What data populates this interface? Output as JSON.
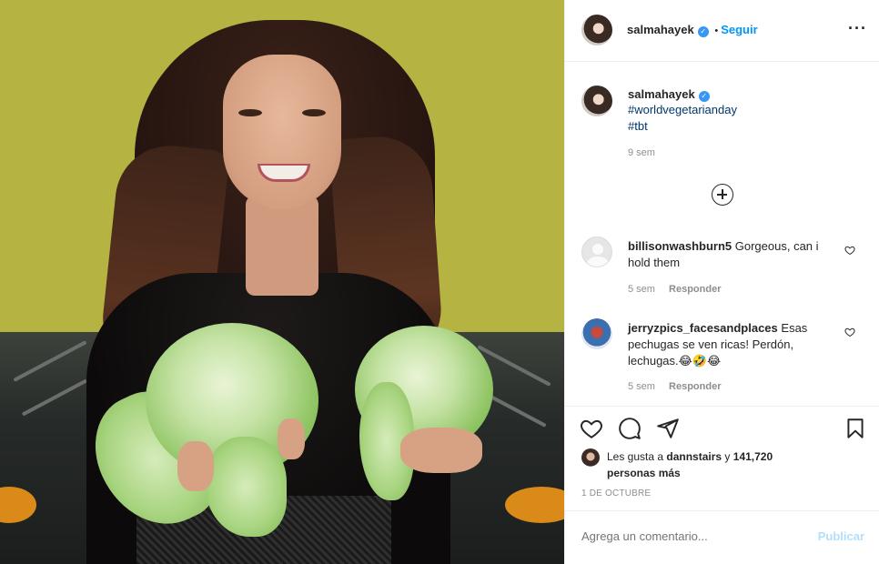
{
  "post": {
    "username": "salmahayek",
    "follow_label": "Seguir",
    "more_icon": "more-options-icon",
    "photo_description_icon": "post-photo"
  },
  "caption": {
    "username": "salmahayek",
    "hashtags": [
      "#worldvegetarianday",
      "#tbt"
    ],
    "time": "9 sem"
  },
  "comments": [
    {
      "username": "billisonwashburn5",
      "text": "Gorgeous, can i hold them",
      "time": "5 sem",
      "reply_label": "Responder"
    },
    {
      "username": "jerryzpics_facesandplaces",
      "text": "Esas pechugas se ven ricas! Perdón, lechugas.😂🤣😂",
      "time": "5 sem",
      "reply_label": "Responder"
    }
  ],
  "likes": {
    "prefix": "Les gusta a",
    "liked_by": "dannstairs",
    "joiner": "y",
    "count": "141,720",
    "suffix": "personas más"
  },
  "date": "1 DE OCTUBRE",
  "comment_box": {
    "placeholder": "Agrega un comentario...",
    "publish_label": "Publicar"
  },
  "colors": {
    "accent": "#0095f6",
    "publish_disabled": "#b2dffc",
    "hashtag": "#00376b",
    "meta": "#8e8e8e",
    "photo_background": "#b5b442"
  }
}
